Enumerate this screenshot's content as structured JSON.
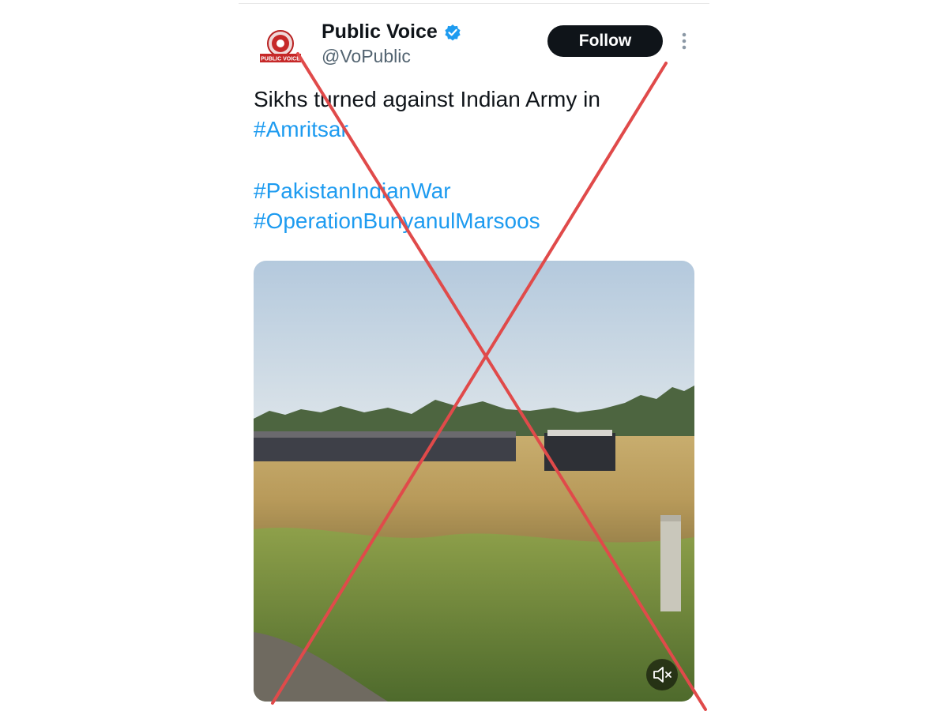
{
  "author": {
    "display_name": "Public Voice",
    "handle": "@VoPublic",
    "avatar_text": "PUBLIC VOICE",
    "verified": true
  },
  "actions": {
    "follow_label": "Follow"
  },
  "tweet": {
    "line1": "Sikhs turned against Indian Army in",
    "hashtags": [
      "#Amritsar",
      "#PakistanIndianWar",
      "#OperationBunyanulMarsoos"
    ]
  },
  "media": {
    "type": "video",
    "muted": true
  },
  "overlay": {
    "cross_color": "#e04a4a"
  },
  "colors": {
    "hashtag": "#1d9bf0",
    "verified": "#1d9bf0",
    "follow_bg": "#0f1419"
  }
}
